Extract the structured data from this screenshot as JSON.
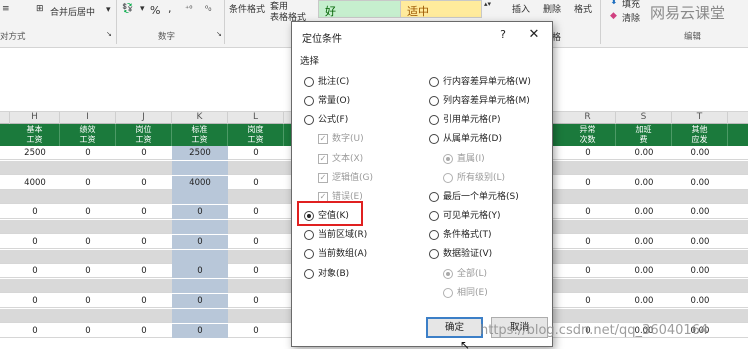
{
  "ribbon": {
    "wrap_label": "对方式",
    "merge_center": "合并后居中",
    "number_group": "数字",
    "percent": "%",
    "comma": ",",
    "cond_format": "条件格式",
    "table_format": "套用\n表格格式",
    "style_good": "好",
    "style_neutral": "适中",
    "insert": "插入",
    "delete": "删除",
    "format": "格式",
    "fill": "填充",
    "clear": "清除",
    "edit_group": "编辑"
  },
  "brand": "网易云课堂",
  "columns": [
    "H",
    "I",
    "J",
    "K",
    "L",
    "R",
    "S",
    "T"
  ],
  "header_labels": [
    "基本\n工资",
    "绩效\n工资",
    "岗位\n工资",
    "标准\n工资",
    "岗度\n工资",
    "异常\n次数",
    "加班\n费",
    "其他\n应发"
  ],
  "rows": [
    {
      "vals": [
        "2500",
        "0",
        "0",
        "2500",
        "0"
      ],
      "right": [
        "0",
        "0.00",
        "0.00"
      ]
    },
    {
      "vals": [
        "",
        "",
        "",
        "",
        ""
      ],
      "right": [
        "",
        "",
        ""
      ]
    },
    {
      "vals": [
        "4000",
        "0",
        "0",
        "4000",
        "0"
      ],
      "right": [
        "0",
        "0.00",
        "0.00"
      ]
    },
    {
      "vals": [
        "",
        "",
        "",
        "",
        ""
      ],
      "right": [
        "",
        "",
        ""
      ]
    },
    {
      "vals": [
        "0",
        "0",
        "0",
        "0",
        "0"
      ],
      "right": [
        "0",
        "0.00",
        "0.00"
      ]
    },
    {
      "vals": [
        "",
        "",
        "",
        "",
        ""
      ],
      "right": [
        "",
        "",
        ""
      ]
    },
    {
      "vals": [
        "0",
        "0",
        "0",
        "0",
        "0"
      ],
      "right": [
        "0",
        "0.00",
        "0.00"
      ]
    },
    {
      "vals": [
        "",
        "",
        "",
        "",
        ""
      ],
      "right": [
        "",
        "",
        ""
      ]
    },
    {
      "vals": [
        "0",
        "0",
        "0",
        "0",
        "0"
      ],
      "right": [
        "0",
        "0.00",
        "0.00"
      ]
    },
    {
      "vals": [
        "",
        "",
        "",
        "",
        ""
      ],
      "right": [
        "",
        "",
        ""
      ]
    },
    {
      "vals": [
        "0",
        "0",
        "0",
        "0",
        "0"
      ],
      "right": [
        "0",
        "0.00",
        "0.00"
      ]
    },
    {
      "vals": [
        "",
        "",
        "",
        "",
        ""
      ],
      "right": [
        "",
        "",
        ""
      ]
    },
    {
      "vals": [
        "0",
        "0",
        "0",
        "0",
        "0"
      ],
      "right": [
        "0",
        "0.00",
        "0.00"
      ]
    }
  ],
  "dialog": {
    "title": "定位条件",
    "help": "?",
    "close": "✕",
    "section": "选择",
    "left_options": [
      {
        "label": "批注(C)",
        "kind": "radio",
        "state": "off",
        "enabled": true
      },
      {
        "label": "常量(O)",
        "kind": "radio",
        "state": "off",
        "enabled": true
      },
      {
        "label": "公式(F)",
        "kind": "radio",
        "state": "off",
        "enabled": true
      },
      {
        "label": "数字(U)",
        "kind": "check",
        "state": "on",
        "enabled": false
      },
      {
        "label": "文本(X)",
        "kind": "check",
        "state": "on",
        "enabled": false
      },
      {
        "label": "逻辑值(G)",
        "kind": "check",
        "state": "on",
        "enabled": false
      },
      {
        "label": "错误(E)",
        "kind": "check",
        "state": "on",
        "enabled": false
      },
      {
        "label": "空值(K)",
        "kind": "radio",
        "state": "on",
        "enabled": true
      },
      {
        "label": "当前区域(R)",
        "kind": "radio",
        "state": "off",
        "enabled": true
      },
      {
        "label": "当前数组(A)",
        "kind": "radio",
        "state": "off",
        "enabled": true
      },
      {
        "label": "对象(B)",
        "kind": "radio",
        "state": "off",
        "enabled": true
      }
    ],
    "right_options": [
      {
        "label": "行内容差异单元格(W)",
        "kind": "radio",
        "state": "off",
        "enabled": true
      },
      {
        "label": "列内容差异单元格(M)",
        "kind": "radio",
        "state": "off",
        "enabled": true
      },
      {
        "label": "引用单元格(P)",
        "kind": "radio",
        "state": "off",
        "enabled": true
      },
      {
        "label": "从属单元格(D)",
        "kind": "radio",
        "state": "off",
        "enabled": true
      },
      {
        "label": "直属(I)",
        "kind": "radio",
        "state": "on",
        "enabled": false
      },
      {
        "label": "所有级别(L)",
        "kind": "radio",
        "state": "off",
        "enabled": false
      },
      {
        "label": "最后一个单元格(S)",
        "kind": "radio",
        "state": "off",
        "enabled": true
      },
      {
        "label": "可见单元格(Y)",
        "kind": "radio",
        "state": "off",
        "enabled": true
      },
      {
        "label": "条件格式(T)",
        "kind": "radio",
        "state": "off",
        "enabled": true
      },
      {
        "label": "数据验证(V)",
        "kind": "radio",
        "state": "off",
        "enabled": true
      },
      {
        "label": "全部(L)",
        "kind": "radio",
        "state": "on",
        "enabled": false
      },
      {
        "label": "相同(E)",
        "kind": "radio",
        "state": "off",
        "enabled": false
      }
    ],
    "ok": "确定",
    "cancel": "取消"
  },
  "watermark": "https://blog.csdn.net/qq_36040164",
  "colors": {
    "header_green": "#1b7a3c",
    "highlight_red": "#e02020",
    "ok_border": "#3c7fc7"
  }
}
